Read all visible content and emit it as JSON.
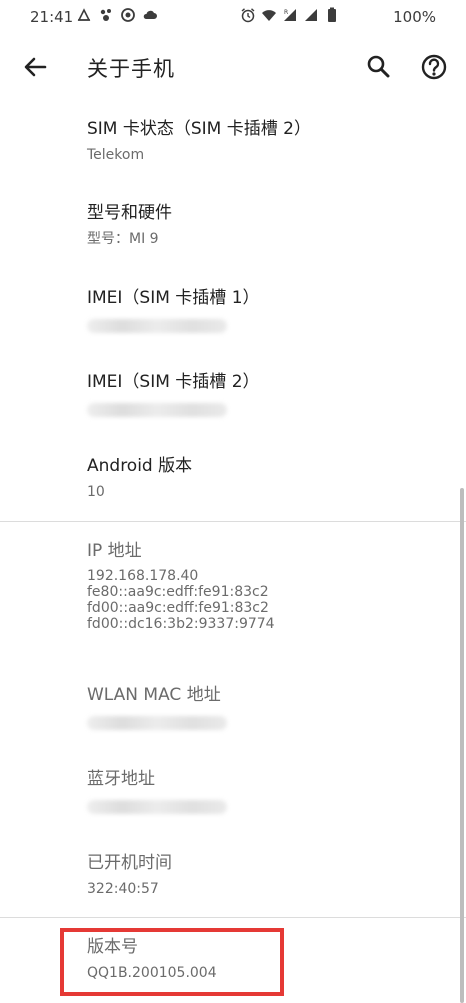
{
  "statusbar": {
    "time": "21:41",
    "battery": "100%",
    "left_icons": [
      "notification-icon",
      "app-icon",
      "sync-icon",
      "cloud-icon"
    ],
    "right_icons": [
      "alarm-icon",
      "wifi-icon",
      "signal-r-icon",
      "signal-icon",
      "battery-icon"
    ]
  },
  "toolbar": {
    "title": "关于手机"
  },
  "items": [
    {
      "title": "SIM 卡状态（SIM 卡插槽 2）",
      "subtitle": "Telekom"
    },
    {
      "title": "型号和硬件",
      "subtitle": "型号：MI 9"
    },
    {
      "title": "IMEI（SIM 卡插槽 1）",
      "subtitle": ""
    },
    {
      "title": "IMEI（SIM 卡插槽 2）",
      "subtitle": ""
    },
    {
      "title": "Android 版本",
      "subtitle": "10"
    },
    {
      "title": "IP 地址",
      "lines": [
        "192.168.178.40",
        "fe80::aa9c:edff:fe91:83c2",
        "fd00::aa9c:edff:fe91:83c2",
        "fd00::dc16:3b2:9337:9774"
      ]
    },
    {
      "title": "WLAN MAC 地址",
      "subtitle": ""
    },
    {
      "title": "蓝牙地址",
      "subtitle": ""
    },
    {
      "title": "已开机时间",
      "subtitle": "322:40:57"
    },
    {
      "title": "版本号",
      "subtitle": "QQ1B.200105.004"
    }
  ],
  "colors": {
    "highlight": "#e53935",
    "text_primary": "#222222",
    "text_secondary": "#6b6b6b"
  }
}
